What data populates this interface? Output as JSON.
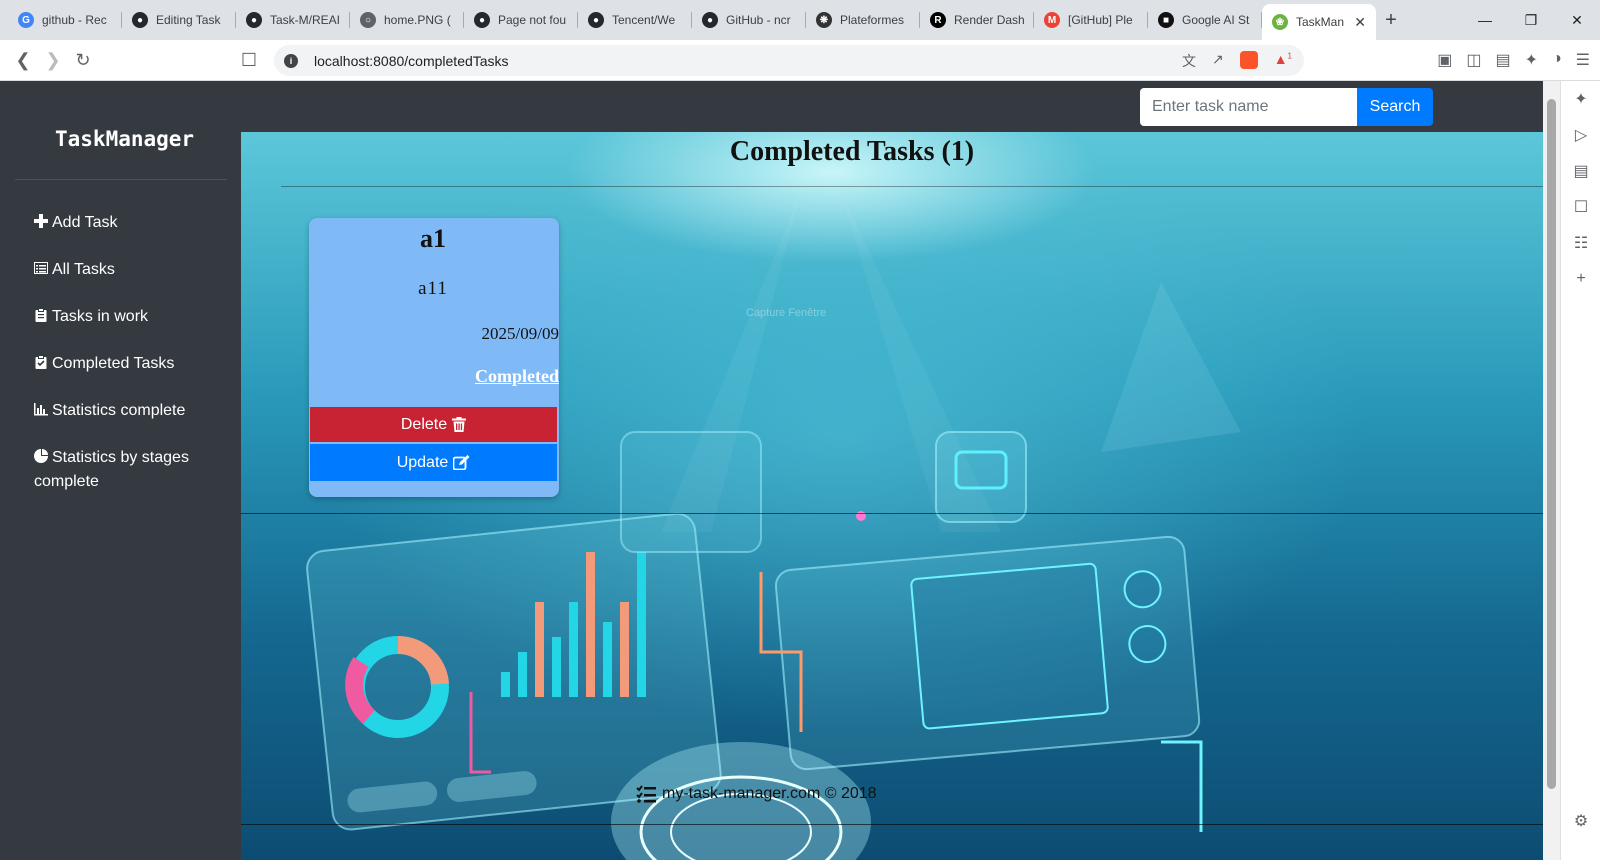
{
  "browser": {
    "tabs": [
      {
        "title": "github - Rec",
        "icon": "google-icon",
        "color": "#4285f4"
      },
      {
        "title": "Editing Task",
        "icon": "github-icon",
        "color": "#24292e"
      },
      {
        "title": "Task-M/REAI",
        "icon": "github-icon",
        "color": "#24292e"
      },
      {
        "title": "home.PNG (",
        "icon": "globe-icon",
        "color": "#5f6368"
      },
      {
        "title": "Page not fou",
        "icon": "github-icon",
        "color": "#24292e"
      },
      {
        "title": "Tencent/We",
        "icon": "github-icon",
        "color": "#24292e"
      },
      {
        "title": "GitHub - ncr",
        "icon": "github-icon",
        "color": "#24292e"
      },
      {
        "title": "Plateformes",
        "icon": "openai-icon",
        "color": "#333333"
      },
      {
        "title": "Render Dash",
        "icon": "render-icon",
        "color": "#000000"
      },
      {
        "title": "[GitHub] Ple",
        "icon": "gmail-icon",
        "color": "#ea4335"
      },
      {
        "title": "Google AI St",
        "icon": "ai-studio-icon",
        "color": "#111111"
      },
      {
        "title": "TaskMan",
        "icon": "spring-leaf-icon",
        "color": "#6db33f",
        "active": true
      }
    ],
    "url": "localhost:8080/completedTasks",
    "brave_badge": "1"
  },
  "sidebar": {
    "brand": "TaskManager",
    "items": [
      {
        "label": "Add Task",
        "icon": "plus-icon"
      },
      {
        "label": "All Tasks",
        "icon": "list-icon"
      },
      {
        "label": "Tasks in work",
        "icon": "clipboard-icon"
      },
      {
        "label": "Completed Tasks",
        "icon": "clipboard-check-icon"
      },
      {
        "label": "Statistics complete",
        "icon": "bar-chart-icon"
      },
      {
        "label": "Statistics by stages complete",
        "icon": "pie-chart-icon"
      }
    ]
  },
  "search": {
    "placeholder": "Enter task name",
    "button_label": "Search"
  },
  "main": {
    "title": "Completed Tasks (1)",
    "background_text": "Capture Fenêtre"
  },
  "tasks": [
    {
      "name": "a1",
      "description": "a11",
      "date": "2025/09/09",
      "status": "Completed",
      "delete_label": "Delete",
      "update_label": "Update"
    }
  ],
  "footer": {
    "text": "my-task-manager.com © 2018"
  },
  "colors": {
    "sidebar_bg": "#343a40",
    "card_bg": "#7fbaf7",
    "delete": "#c82333",
    "primary": "#007bff"
  }
}
